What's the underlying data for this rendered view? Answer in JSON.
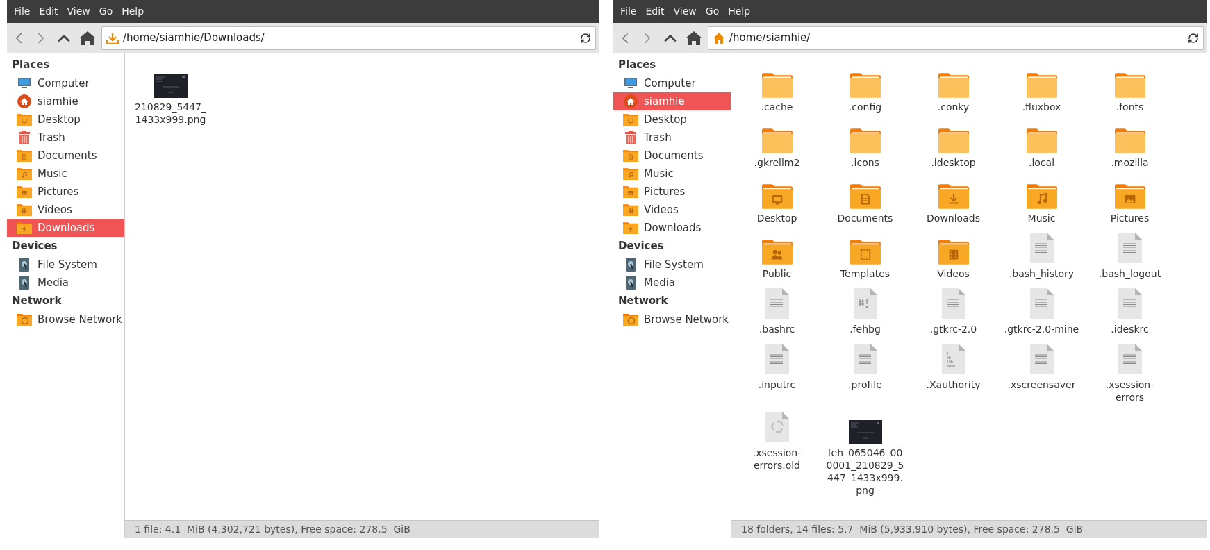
{
  "windows": [
    {
      "menu": [
        "File",
        "Edit",
        "View",
        "Go",
        "Help"
      ],
      "address": {
        "kind": "downloads",
        "text": "/home/siamhie/Downloads/"
      },
      "sidebar": [
        {
          "heading": "Places",
          "items": [
            {
              "label": "Computer",
              "kind": "computer",
              "selected": false
            },
            {
              "label": "siamhie",
              "kind": "home",
              "selected": false
            },
            {
              "label": "Desktop",
              "kind": "desktop",
              "selected": false
            },
            {
              "label": "Trash",
              "kind": "trash",
              "selected": false
            },
            {
              "label": "Documents",
              "kind": "documents",
              "selected": false
            },
            {
              "label": "Music",
              "kind": "music",
              "selected": false
            },
            {
              "label": "Pictures",
              "kind": "pictures",
              "selected": false
            },
            {
              "label": "Videos",
              "kind": "videos",
              "selected": false
            },
            {
              "label": "Downloads",
              "kind": "downloads",
              "selected": true
            }
          ]
        },
        {
          "heading": "Devices",
          "items": [
            {
              "label": "File System",
              "kind": "drive",
              "selected": false
            },
            {
              "label": "Media",
              "kind": "drive",
              "selected": false
            }
          ]
        },
        {
          "heading": "Network",
          "items": [
            {
              "label": "Browse Network",
              "kind": "network",
              "selected": false
            }
          ]
        }
      ],
      "files": [
        {
          "name": "210829_5447_\n1433x999.png",
          "kind": "image"
        }
      ],
      "status": "1 file: 4.1  MiB (4,302,721 bytes), Free space: 278.5  GiB"
    },
    {
      "menu": [
        "File",
        "Edit",
        "View",
        "Go",
        "Help"
      ],
      "address": {
        "kind": "home",
        "text": "/home/siamhie/"
      },
      "sidebar": [
        {
          "heading": "Places",
          "items": [
            {
              "label": "Computer",
              "kind": "computer",
              "selected": false
            },
            {
              "label": "siamhie",
              "kind": "home",
              "selected": true
            },
            {
              "label": "Desktop",
              "kind": "desktop",
              "selected": false
            },
            {
              "label": "Trash",
              "kind": "trash",
              "selected": false
            },
            {
              "label": "Documents",
              "kind": "documents",
              "selected": false
            },
            {
              "label": "Music",
              "kind": "music",
              "selected": false
            },
            {
              "label": "Pictures",
              "kind": "pictures",
              "selected": false
            },
            {
              "label": "Videos",
              "kind": "videos",
              "selected": false
            },
            {
              "label": "Downloads",
              "kind": "downloads",
              "selected": false
            }
          ]
        },
        {
          "heading": "Devices",
          "items": [
            {
              "label": "File System",
              "kind": "drive",
              "selected": false
            },
            {
              "label": "Media",
              "kind": "drive",
              "selected": false
            }
          ]
        },
        {
          "heading": "Network",
          "items": [
            {
              "label": "Browse Network",
              "kind": "network",
              "selected": false
            }
          ]
        }
      ],
      "files": [
        {
          "name": ".cache",
          "kind": "folder"
        },
        {
          "name": ".config",
          "kind": "folder"
        },
        {
          "name": ".conky",
          "kind": "folder"
        },
        {
          "name": ".fluxbox",
          "kind": "folder"
        },
        {
          "name": ".fonts",
          "kind": "folder"
        },
        {
          "name": ".gkrellm2",
          "kind": "folder"
        },
        {
          "name": ".icons",
          "kind": "folder"
        },
        {
          "name": ".idesktop",
          "kind": "folder"
        },
        {
          "name": ".local",
          "kind": "folder"
        },
        {
          "name": ".mozilla",
          "kind": "folder"
        },
        {
          "name": "Desktop",
          "kind": "desktop"
        },
        {
          "name": "Documents",
          "kind": "documents"
        },
        {
          "name": "Downloads",
          "kind": "downloads"
        },
        {
          "name": "Music",
          "kind": "music"
        },
        {
          "name": "Pictures",
          "kind": "pictures"
        },
        {
          "name": "Public",
          "kind": "public"
        },
        {
          "name": "Templates",
          "kind": "templates"
        },
        {
          "name": "Videos",
          "kind": "videos"
        },
        {
          "name": ".bash_history",
          "kind": "text"
        },
        {
          "name": ".bash_logout",
          "kind": "text"
        },
        {
          "name": ".bashrc",
          "kind": "text"
        },
        {
          "name": ".fehbg",
          "kind": "script"
        },
        {
          "name": ".gtkrc-2.0",
          "kind": "text"
        },
        {
          "name": ".gtkrc-2.0-mine",
          "kind": "text"
        },
        {
          "name": ".ideskrc",
          "kind": "text"
        },
        {
          "name": ".inputrc",
          "kind": "text"
        },
        {
          "name": ".profile",
          "kind": "text"
        },
        {
          "name": ".Xauthority",
          "kind": "binary"
        },
        {
          "name": ".xscreensaver",
          "kind": "text"
        },
        {
          "name": ".xsession-\nerrors",
          "kind": "text"
        },
        {
          "name": ".xsession-\nerrors.old",
          "kind": "recycle"
        },
        {
          "name": "feh_065046_00\n0001_210829_5\n447_1433x999.\npng",
          "kind": "image"
        }
      ],
      "status": "18 folders, 14 files: 5.7  MiB (5,933,910 bytes), Free space: 278.5  GiB"
    }
  ]
}
